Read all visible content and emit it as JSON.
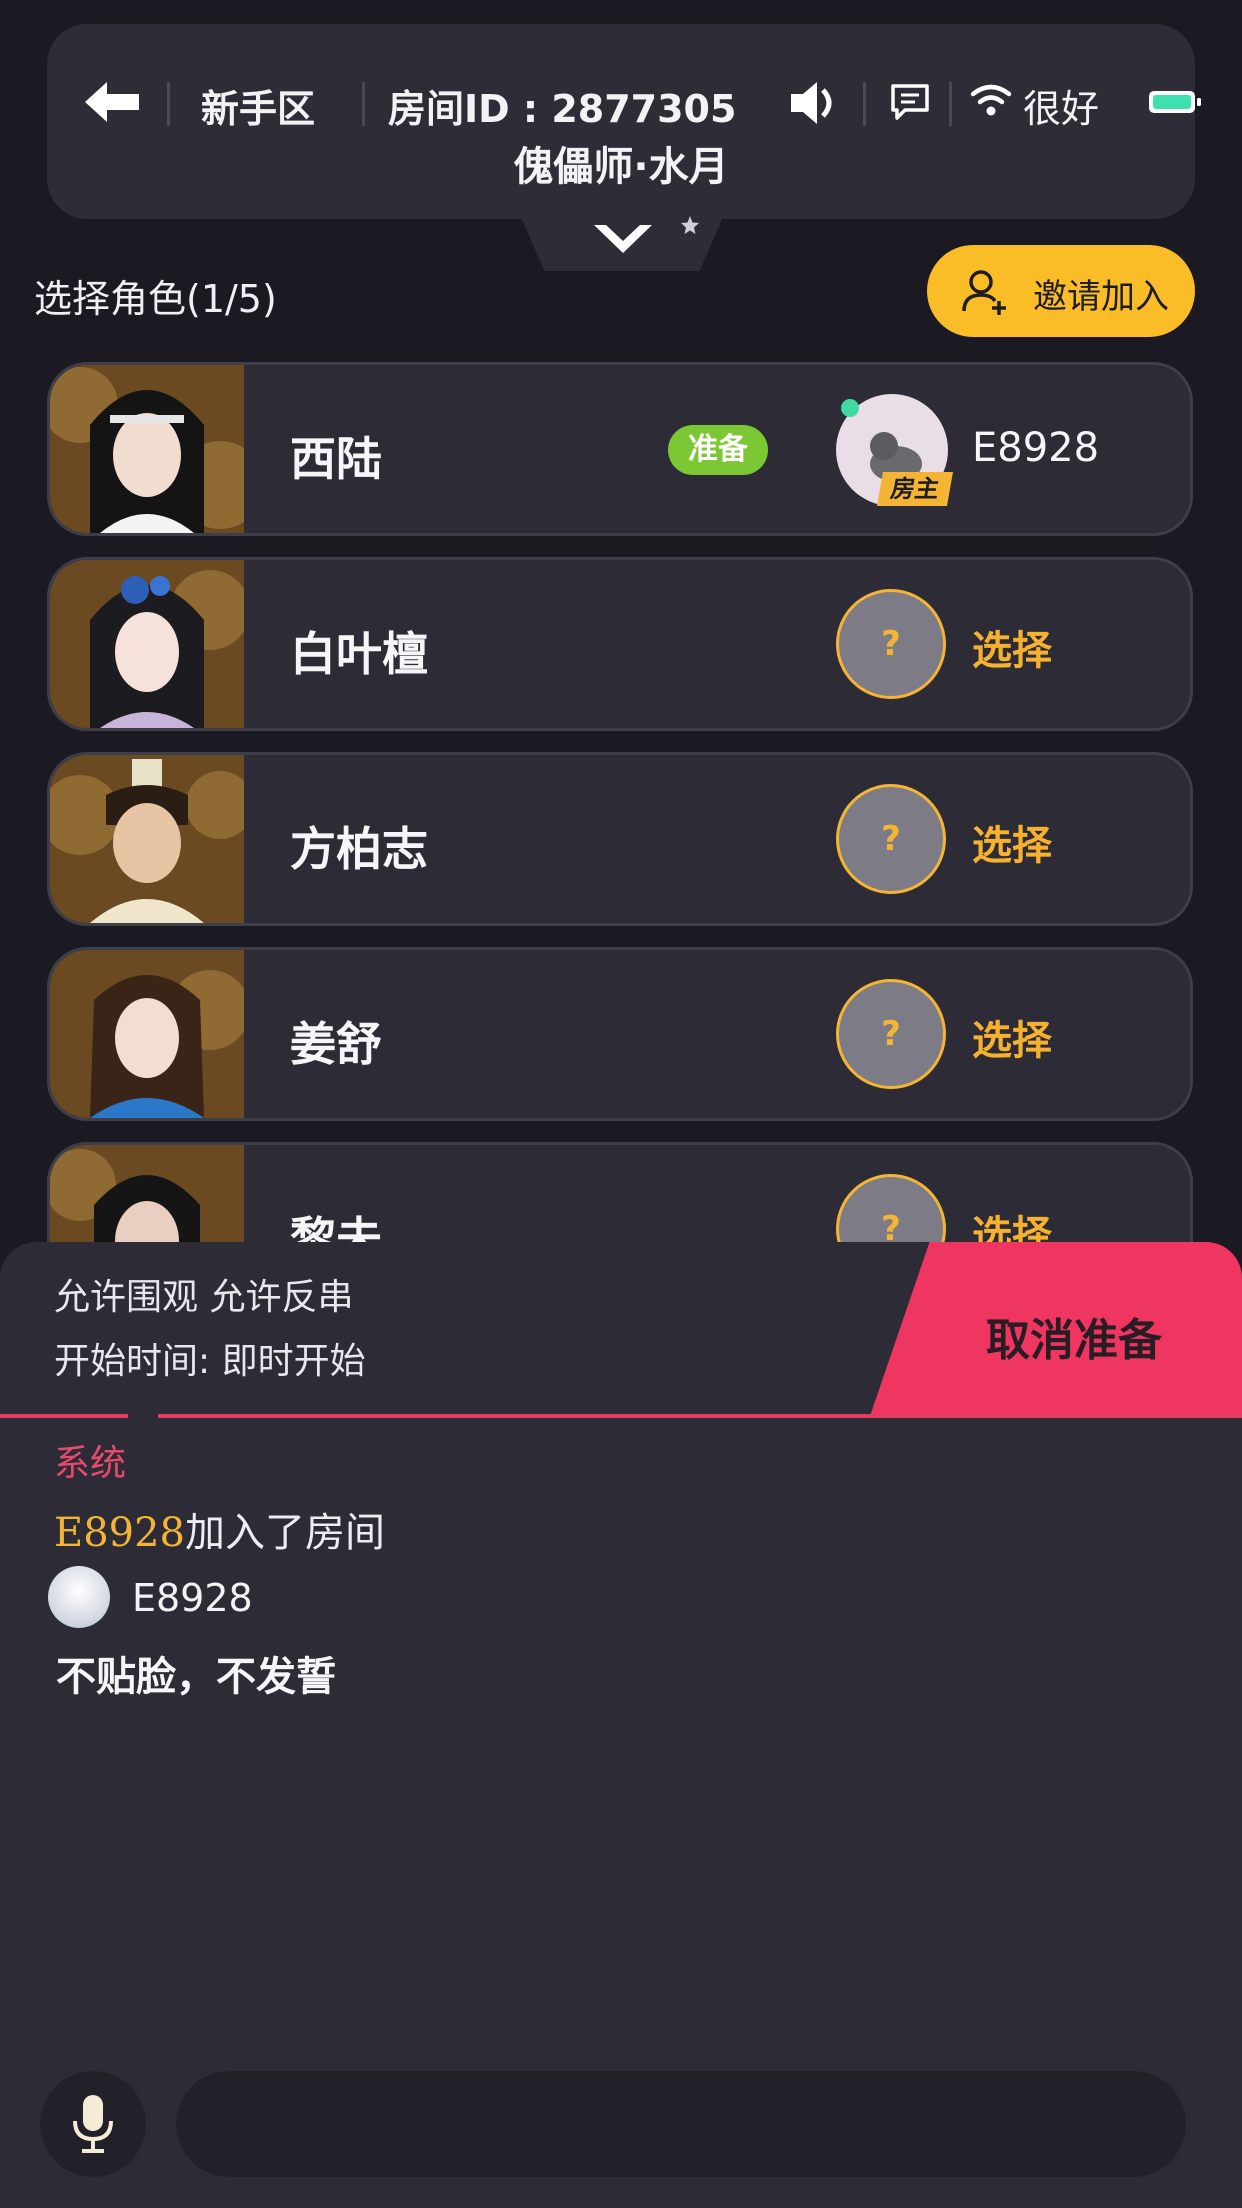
{
  "header": {
    "zone": "新手区",
    "room_id": "房间ID : 2877305",
    "signal_text": "很好",
    "room_title": "傀儡师·水月"
  },
  "select": {
    "title": "选择角色(1/5)",
    "invite_label": "邀请加入"
  },
  "roles": [
    {
      "name": "西陆",
      "status": "准备",
      "player": "E8928",
      "host_label": "房主"
    },
    {
      "name": "白叶檀",
      "placeholder": "?",
      "action": "选择"
    },
    {
      "name": "方柏志",
      "placeholder": "?",
      "action": "选择"
    },
    {
      "name": "姜舒",
      "placeholder": "?",
      "action": "选择"
    },
    {
      "name": "黎未",
      "placeholder": "?",
      "action": "选择"
    }
  ],
  "settings": {
    "options": "允许围观 允许反串",
    "start_time": "开始时间: 即时开始",
    "cancel_label": "取消准备"
  },
  "chat": {
    "system_label": "系统",
    "join_user": "E8928",
    "join_text": "加入了房间",
    "message_user": "E8928",
    "message_text": "不贴脸，不发誓"
  },
  "colors": {
    "accent_yellow": "#fbbd27",
    "cancel_pink": "#ee3660",
    "ready_green": "#7cc734",
    "online_dot": "#3fd9a4",
    "battery": "#3fe0b0"
  }
}
